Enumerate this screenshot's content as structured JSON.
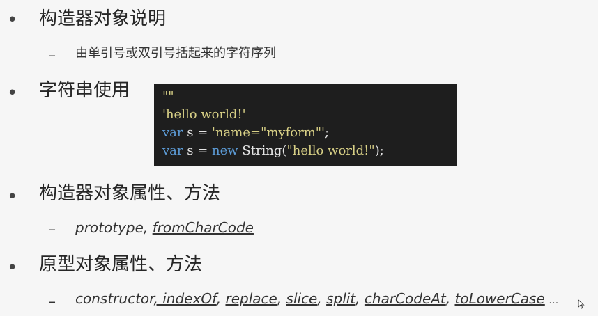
{
  "sections": {
    "s1": {
      "heading": "构造器对象说明",
      "sub": "由单引号或双引号括起来的字符序列"
    },
    "s2": {
      "heading": "字符串使用",
      "code": {
        "line1": "\"\"",
        "line2": "'hello world!'",
        "line3": {
          "kw": "var",
          "rest_a": " s = ",
          "str": "'name=\"myform\"'",
          "rest_b": ";"
        },
        "line4": {
          "kw": "var",
          "rest_a": " s = ",
          "kw2": "new",
          "rest_b": " String(",
          "str": "\"hello world!\"",
          "rest_c": ");"
        }
      }
    },
    "s3": {
      "heading": "构造器对象属性、方法",
      "item1": "prototype",
      "sep": ", ",
      "item2": "fromCharCode"
    },
    "s4": {
      "heading": "原型对象属性、方法",
      "item1": "constructor",
      "item2": ", indexOf",
      "item3": "replace",
      "item4": "slice",
      "item5": "split",
      "item6": "charCodeAt",
      "item7": "toLowerCase",
      "sep": ", ",
      "ellipsis": "…"
    }
  },
  "symbols": {
    "bullet": "•",
    "dash": "–"
  },
  "colors": {
    "code_bg": "#1e1e1e",
    "code_string": "#d8d086",
    "code_keyword": "#5c9bd6",
    "code_plain": "#e6e6e6"
  }
}
